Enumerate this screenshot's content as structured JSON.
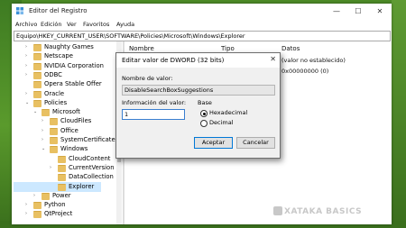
{
  "window": {
    "title": "Editor del Registro",
    "controls": {
      "minimize": "—",
      "maximize": "☐",
      "close": "✕"
    }
  },
  "menu": [
    "Archivo",
    "Edición",
    "Ver",
    "Favoritos",
    "Ayuda"
  ],
  "address": "Equipo\\HKEY_CURRENT_USER\\SOFTWARE\\Policies\\Microsoft\\Windows\\Explorer",
  "tree": [
    {
      "label": "Naughty Games",
      "level": 0,
      "expander": "›"
    },
    {
      "label": "Netscape",
      "level": 0,
      "expander": "›"
    },
    {
      "label": "NVIDIA Corporation",
      "level": 0,
      "expander": "›"
    },
    {
      "label": "ODBC",
      "level": 0,
      "expander": "›"
    },
    {
      "label": "Opera Stable Offer",
      "level": 0,
      "expander": ""
    },
    {
      "label": "Oracle",
      "level": 0,
      "expander": "›"
    },
    {
      "label": "Policies",
      "level": 0,
      "expander": "⌄"
    },
    {
      "label": "Microsoft",
      "level": 1,
      "expander": "⌄"
    },
    {
      "label": "CloudFiles",
      "level": 2,
      "expander": "›"
    },
    {
      "label": "Office",
      "level": 2,
      "expander": "›"
    },
    {
      "label": "SystemCertificates",
      "level": 2,
      "expander": "›"
    },
    {
      "label": "Windows",
      "level": 2,
      "expander": "⌄"
    },
    {
      "label": "CloudContent",
      "level": 3,
      "expander": ""
    },
    {
      "label": "CurrentVersion",
      "level": 3,
      "expander": "›"
    },
    {
      "label": "DataCollection",
      "level": 3,
      "expander": ""
    },
    {
      "label": "Explorer",
      "level": 3,
      "expander": "",
      "selected": true
    },
    {
      "label": "Power",
      "level": 1,
      "expander": "›"
    },
    {
      "label": "Python",
      "level": 0,
      "expander": "›"
    },
    {
      "label": "QtProject",
      "level": 0,
      "expander": "›"
    }
  ],
  "list": {
    "headers": {
      "name": "Nombre",
      "type": "Tipo",
      "data": "Datos"
    },
    "rows": [
      {
        "data": "(valor no establecido)"
      },
      {
        "data": "0x00000000 (0)"
      }
    ]
  },
  "dialog": {
    "title": "Editar valor de DWORD (32 bits)",
    "close": "✕",
    "name_label": "Nombre de valor:",
    "name_value": "DisableSearchBoxSuggestions",
    "value_label": "Información del valor:",
    "value": "1",
    "base_label": "Base",
    "radio_hex": "Hexadecimal",
    "radio_dec": "Decimal",
    "base_selected": "Hexadecimal",
    "accept": "Aceptar",
    "cancel": "Cancelar"
  },
  "watermark": "XATAKA BASICS",
  "colors": {
    "accent": "#0078d7",
    "background": "#4c8a27",
    "folder": "#e8c062"
  }
}
